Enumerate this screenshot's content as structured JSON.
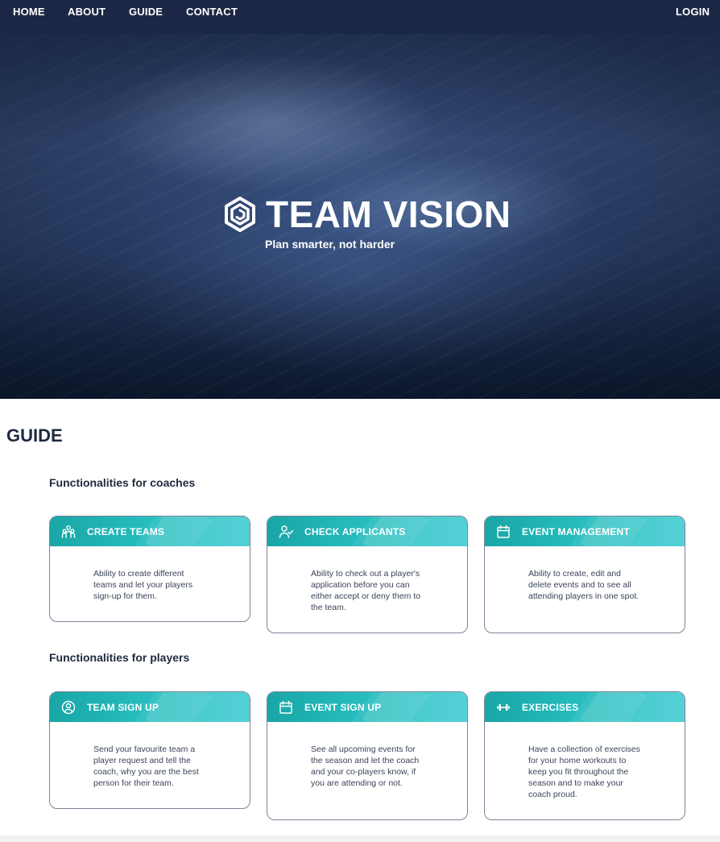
{
  "nav": {
    "items": [
      "HOME",
      "ABOUT",
      "GUIDE",
      "CONTACT"
    ],
    "login_label": "LOGIN"
  },
  "hero": {
    "logo_icon": "team-vision-logo-icon",
    "title": "TEAM VISION",
    "tagline": "Plan smarter, not harder"
  },
  "guide": {
    "title": "GUIDE",
    "coaches": {
      "heading": "Functionalities for coaches",
      "cards": [
        {
          "icon": "team-icon",
          "title": "CREATE TEAMS",
          "text": "Ability to create different teams and let your players sign-up for them."
        },
        {
          "icon": "user-check-icon",
          "title": "CHECK APPLICANTS",
          "text": "Ability to check out a player's application before you can either accept or deny them to the team."
        },
        {
          "icon": "calendar-icon",
          "title": "EVENT MANAGEMENT",
          "text": "Ability to create, edit and delete events and to see all attending players in one spot."
        }
      ]
    },
    "players": {
      "heading": "Functionalities for players",
      "cards": [
        {
          "icon": "user-circle-icon",
          "title": "TEAM SIGN UP",
          "text": "Send your favourite team a player request and tell the coach, why you are the best person for their team."
        },
        {
          "icon": "calendar-icon",
          "title": "EVENT SIGN UP",
          "text": "See all upcoming events for the season and let the coach and your co-players know, if you are attending or not."
        },
        {
          "icon": "dumbbell-icon",
          "title": "EXERCISES",
          "text": "Have a collection of exercises for your home workouts to keep you fit throughout the season and to make your coach proud."
        }
      ]
    }
  },
  "colors": {
    "nav_bg": "#1b2744",
    "card_header_start": "#19a6a6",
    "card_header_end": "#3ccbd1",
    "text_dark": "#1e2a3f"
  }
}
